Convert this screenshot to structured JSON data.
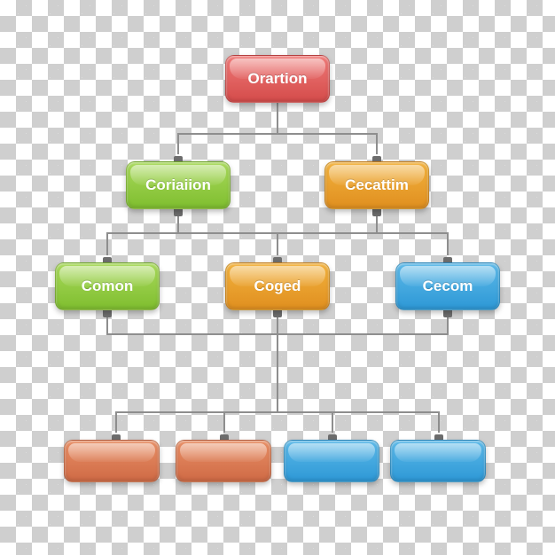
{
  "chart_data": {
    "type": "org-chart",
    "title": "",
    "root": {
      "id": "root",
      "label": "Orartion",
      "color": "red"
    },
    "level2": [
      {
        "id": "l2a",
        "label": "Coriaiion",
        "color": "green"
      },
      {
        "id": "l2b",
        "label": "Cecattim",
        "color": "orange"
      }
    ],
    "level3": [
      {
        "id": "l3a",
        "label": "Comon",
        "color": "green"
      },
      {
        "id": "l3b",
        "label": "Coged",
        "color": "orange"
      },
      {
        "id": "l3c",
        "label": "Cecom",
        "color": "blue"
      }
    ],
    "level4": [
      {
        "id": "l4a",
        "label": "",
        "color": "rust"
      },
      {
        "id": "l4b",
        "label": "",
        "color": "rust"
      },
      {
        "id": "l4c",
        "label": "",
        "color": "blue"
      },
      {
        "id": "l4d",
        "label": "",
        "color": "blue"
      }
    ]
  },
  "colors": {
    "red": "#d44b4a",
    "green": "#7fbe2f",
    "orange": "#e08f1f",
    "blue": "#2d98d6",
    "rust": "#cf6a45",
    "connector": "#8e8e8e"
  }
}
